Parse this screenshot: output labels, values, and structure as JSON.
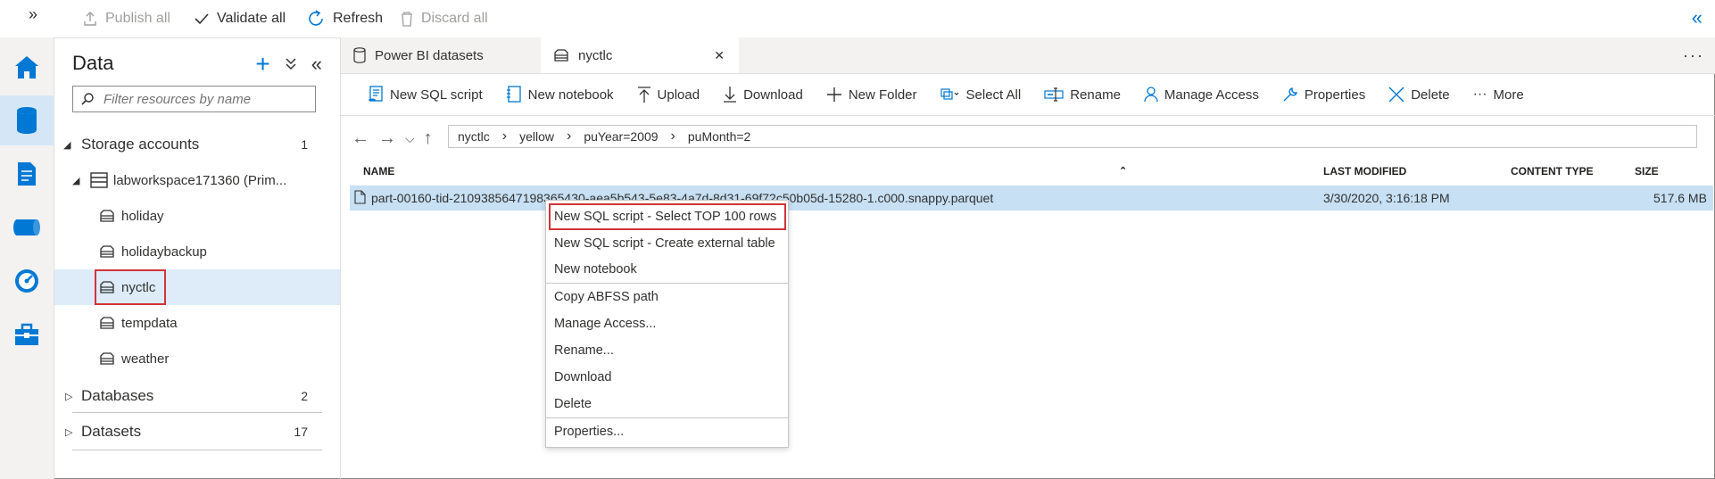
{
  "topbar": {
    "expand": "»",
    "publish_all": "Publish all",
    "validate_all": "Validate all",
    "refresh": "Refresh",
    "discard_all": "Discard all",
    "collapse": "«"
  },
  "explorer": {
    "title": "Data",
    "add": "+",
    "collapse_all": "⌄⌄",
    "hide": "«",
    "filter_placeholder": "Filter resources by name",
    "sections": [
      {
        "label": "Storage accounts",
        "count": "1"
      },
      {
        "label": "Databases",
        "count": "2"
      },
      {
        "label": "Datasets",
        "count": "17"
      }
    ],
    "account": "labworkspace171360 (Prim...",
    "containers": [
      "holiday",
      "holidaybackup",
      "nyctlc",
      "tempdata",
      "weather"
    ]
  },
  "tabs": [
    {
      "label": "Power BI datasets"
    },
    {
      "label": "nyctlc",
      "close": "✕"
    }
  ],
  "tabs_more": "···",
  "commands": [
    "New SQL script",
    "New notebook",
    "Upload",
    "Download",
    "New Folder",
    "Select All",
    "Rename",
    "Manage Access",
    "Properties",
    "Delete",
    "More"
  ],
  "breadcrumb": [
    "nyctlc",
    "yellow",
    "puYear=2009",
    "puMonth=2"
  ],
  "breadcrumb_sep": "›",
  "columns": {
    "name": "NAME",
    "last_modified": "LAST MODIFIED",
    "content_type": "CONTENT TYPE",
    "size": "SIZE"
  },
  "file": {
    "name": "part-00160-tid-2109385647198365430-aea5b543-5e83-4a7d-8d31-69f72c50b05d-15280-1.c000.snappy.parquet",
    "last_modified": "3/30/2020, 3:16:18 PM",
    "content_type": "",
    "size": "517.6 MB"
  },
  "context_menu": [
    "New SQL script - Select TOP 100 rows",
    "New SQL script - Create external table",
    "New notebook",
    "Copy ABFSS path",
    "Manage Access...",
    "Rename...",
    "Download",
    "Delete",
    "Properties..."
  ],
  "colors": {
    "accent": "#0078d4",
    "highlight_box": "#d13438",
    "selected_row": "#c7e0f4"
  }
}
